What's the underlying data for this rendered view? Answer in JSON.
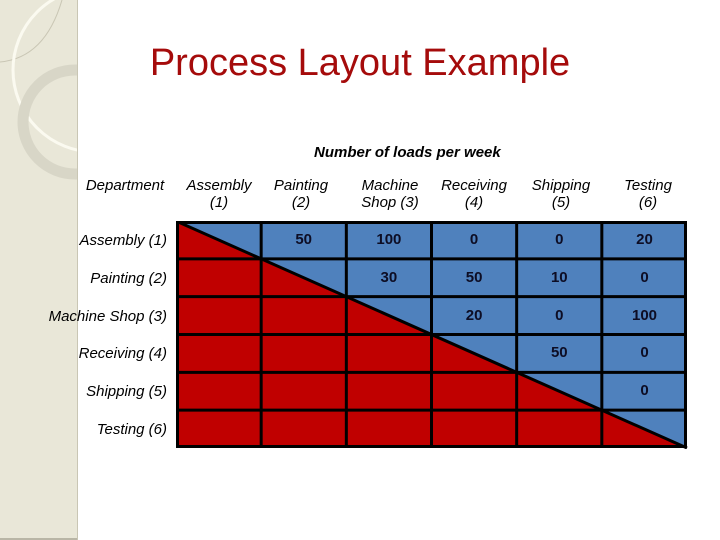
{
  "slide": {
    "title": "Process Layout Example",
    "subtitle": "Number of loads per week"
  },
  "table": {
    "corner_label": "Department",
    "columns": [
      {
        "line1": "Assembly",
        "line2": "(1)"
      },
      {
        "line1": "Painting",
        "line2": "(2)"
      },
      {
        "line1": "Machine",
        "line2": "Shop (3)"
      },
      {
        "line1": "Receiving",
        "line2": "(4)"
      },
      {
        "line1": "Shipping",
        "line2": "(5)"
      },
      {
        "line1": "Testing",
        "line2": "(6)"
      }
    ],
    "rows": [
      {
        "label": "Assembly (1)",
        "cells": [
          "",
          "50",
          "100",
          "0",
          "0",
          "20"
        ]
      },
      {
        "label": "Painting (2)",
        "cells": [
          "",
          "",
          "30",
          "50",
          "10",
          "0"
        ]
      },
      {
        "label": "Machine Shop (3)",
        "cells": [
          "",
          "",
          "",
          "20",
          "0",
          "100"
        ]
      },
      {
        "label": "Receiving (4)",
        "cells": [
          "",
          "",
          "",
          "",
          "50",
          "0"
        ]
      },
      {
        "label": "Shipping (5)",
        "cells": [
          "",
          "",
          "",
          "",
          "",
          "0"
        ]
      },
      {
        "label": "Testing (6)",
        "cells": [
          "",
          "",
          "",
          "",
          "",
          ""
        ]
      }
    ],
    "colors": {
      "upper_triangle": "#4f81bd",
      "lower_triangle": "#c00000",
      "grid": "#000000"
    }
  }
}
